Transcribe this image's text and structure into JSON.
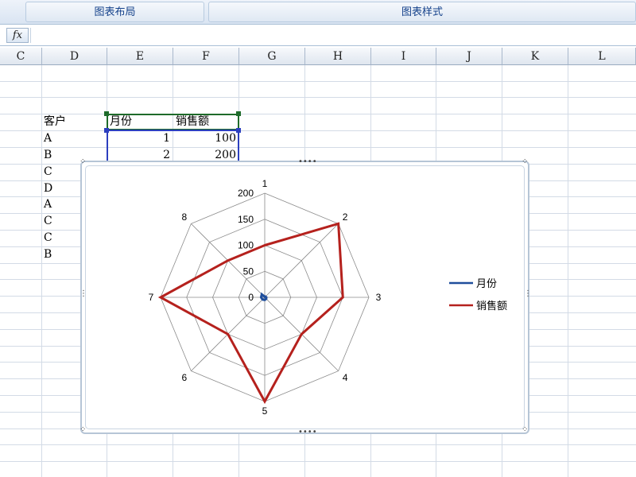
{
  "ribbon": {
    "group1": "图表布局",
    "group2": "图表样式"
  },
  "formula_bar": {
    "fx_label": "fx",
    "value": ""
  },
  "columns": [
    "C",
    "D",
    "E",
    "F",
    "G",
    "H",
    "I",
    "J",
    "K",
    "L"
  ],
  "sheet": {
    "header": {
      "customer": "客户",
      "month": "月份",
      "sales": "销售额"
    },
    "rows": [
      {
        "customer": "A",
        "month": "1",
        "sales": "100"
      },
      {
        "customer": "B",
        "month": "2",
        "sales": "200"
      },
      {
        "customer": "C"
      },
      {
        "customer": "D"
      },
      {
        "customer": "A"
      },
      {
        "customer": "C"
      },
      {
        "customer": "C"
      },
      {
        "customer": "B"
      }
    ]
  },
  "chart_data": {
    "type": "radar",
    "categories": [
      "1",
      "2",
      "3",
      "4",
      "5",
      "6",
      "7",
      "8"
    ],
    "rlim": [
      0,
      200
    ],
    "rticks": [
      0,
      50,
      100,
      150,
      200
    ],
    "grid": true,
    "legend": "right",
    "series": [
      {
        "name": "月份",
        "color": "#1f4e9c",
        "values": [
          1,
          2,
          3,
          4,
          5,
          6,
          7,
          8
        ]
      },
      {
        "name": "销售额",
        "color": "#b5211d",
        "values": [
          100,
          200,
          150,
          100,
          200,
          100,
          200,
          100
        ]
      }
    ]
  },
  "colors": {
    "grid": "#d3dbe6",
    "header_text": "#15428b",
    "selection_green": "#1e6b2a",
    "selection_blue": "#2c3fbf"
  }
}
